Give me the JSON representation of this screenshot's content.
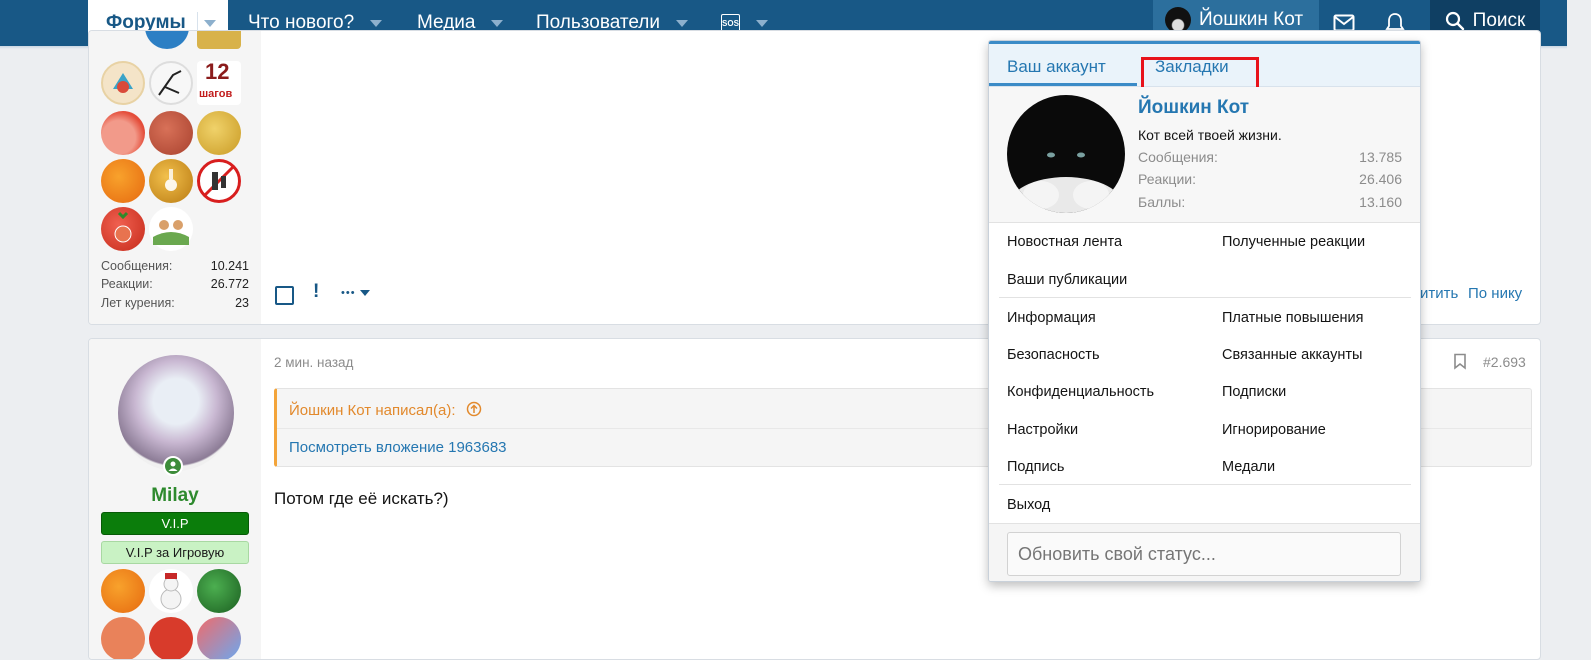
{
  "nav": {
    "forums": "Форумы",
    "whats_new": "Что нового?",
    "media": "Медиа",
    "users": "Пользователи",
    "sos": "SOS",
    "user_name": "Йошкин Кот",
    "search": "Поиск"
  },
  "post1": {
    "badge_12_number": "12",
    "badge_12_text": "шагов",
    "stats": [
      {
        "label": "Сообщения:",
        "value": "10.241"
      },
      {
        "label": "Реакции:",
        "value": "26.772"
      },
      {
        "label": "Лет курения:",
        "value": "23"
      }
    ],
    "action_alert": "!",
    "action_more": "•••",
    "reply_partial": "итить",
    "by_nick": "По нику"
  },
  "post2": {
    "time": "2 мин. назад",
    "post_number": "#2.693",
    "username": "Milay",
    "banner_vip": "V.I.P",
    "banner_vip_game": "V.I.P за Игровую",
    "quote_author": "Йошкин Кот написал(а):",
    "quote_link": "Посмотреть вложение 1963683",
    "body": "Потом где её искать?)"
  },
  "menu": {
    "tab_account": "Ваш аккаунт",
    "tab_bookmarks": "Закладки",
    "profile": {
      "name": "Йошкин Кот",
      "title": "Кот всей твоей жизни.",
      "stats": [
        {
          "label": "Сообщения:",
          "value": "13.785"
        },
        {
          "label": "Реакции:",
          "value": "26.406"
        },
        {
          "label": "Баллы:",
          "value": "13.160"
        }
      ]
    },
    "links_a": {
      "news_feed": "Новостная лента",
      "received_reactions": "Полученные реакции",
      "your_posts": "Ваши публикации"
    },
    "links_b": {
      "info": "Информация",
      "paid_upgrades": "Платные повышения",
      "security": "Безопасность",
      "linked_accounts": "Связанные аккаунты",
      "privacy": "Конфиденциальность",
      "subscriptions": "Подписки",
      "settings": "Настройки",
      "ignoring": "Игнорирование",
      "signature": "Подпись",
      "medals": "Медали"
    },
    "logout": "Выход",
    "status_placeholder": "Обновить свой статус..."
  },
  "colors": {
    "nav_bg": "#185886",
    "link": "#2577b1",
    "highlight": "#e8121a",
    "quote_accent": "#f3a43a",
    "vip_green": "#0f7a0f"
  }
}
